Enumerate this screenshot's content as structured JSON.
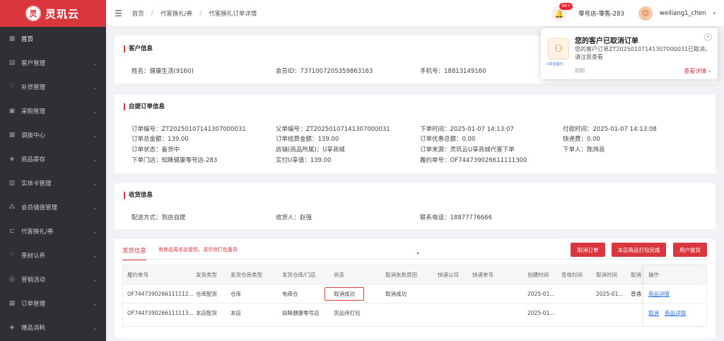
{
  "app": {
    "logo_mark": "灵",
    "logo_text": "灵玑云"
  },
  "sidebar": {
    "items": [
      {
        "label": "首页",
        "icon": "grid-icon",
        "glyph": "▦",
        "arrow": ""
      },
      {
        "label": "客户管理",
        "icon": "customer-icon",
        "glyph": "▤",
        "arrow": "⌄"
      },
      {
        "label": "补货管理",
        "icon": "heart-icon",
        "glyph": "♡",
        "arrow": "⌄"
      },
      {
        "label": "采购管理",
        "icon": "purchase-icon",
        "glyph": "▣",
        "arrow": "⌄"
      },
      {
        "label": "调拨中心",
        "icon": "transfer-icon",
        "glyph": "▦",
        "arrow": "⌄"
      },
      {
        "label": "商品寄存",
        "icon": "box-icon",
        "glyph": "◈",
        "arrow": "⌄"
      },
      {
        "label": "实体卡管理",
        "icon": "card-icon",
        "glyph": "▥",
        "arrow": "⌄"
      },
      {
        "label": "会员储值管理",
        "icon": "member-icon",
        "glyph": "⁂",
        "arrow": "⌄"
      },
      {
        "label": "代客换礼/券",
        "icon": "cart-icon",
        "glyph": "⊏",
        "arrow": "⌄"
      },
      {
        "label": "茶树认养",
        "icon": "tea-icon",
        "glyph": "♡",
        "arrow": "⌄"
      },
      {
        "label": "营销活动",
        "icon": "marketing-icon",
        "glyph": "◎",
        "arrow": "⌄"
      },
      {
        "label": "订单管理",
        "icon": "order-icon",
        "glyph": "▦",
        "arrow": "⌄"
      },
      {
        "label": "赠品消耗",
        "icon": "gift-icon",
        "glyph": "◈",
        "arrow": "⌄"
      }
    ]
  },
  "header": {
    "breadcrumb": [
      "首页",
      "代客换礼/券",
      "代客换礼订单详情"
    ],
    "badge": "99+",
    "store": "零号店-零售-283",
    "username": "weiliang1_chen"
  },
  "toast": {
    "icon_caption": "U享值履约",
    "title": "您的客户已取消订单",
    "body": "您的客户订单ZT20250107141307000031已取消，请注意查看",
    "time": "刚刚",
    "link": "查看详情 ›"
  },
  "customer": {
    "title": "客户信息",
    "name": "姓名：健康生活(9160)",
    "member_id": "会员ID：7371007205359863163",
    "phone": "手机号：18813149160"
  },
  "order": {
    "title": "自提订单信息",
    "fields": [
      "订单编号：ZT20250107141307000031",
      "订单总金额：139.00",
      "订单状态：备货中",
      "下单门店：知睐健康零号店-283",
      "父单编号：ZT20250107141307000031",
      "订单结算金额：139.00",
      "店铺(商品所属)：U享商城",
      "实付U享值：139.00",
      "下单时间：2025-01-07 14:13:07",
      "订单优惠总额：0.00",
      "订单来源：灵玑云U享商城代客下单",
      "履约单号：OF744739026611111300",
      "付款时间：2025-01-07 14:13:08",
      "快递费：0.00",
      "下单人：陈炜良"
    ]
  },
  "receiver": {
    "title": "收货信息",
    "method": "配送方式：到店自提",
    "person": "收货人：赵强",
    "phone": "联系电话：18877776666"
  },
  "shipping": {
    "tab": "发货信息",
    "note": "有商品周本店提供，请尽快打包备货",
    "buttons": [
      "取消订单",
      "本店商品打包完成",
      "用户提货"
    ],
    "columns": [
      "履约单号",
      "发货类型",
      "发货仓库类型",
      "发货仓库/门店",
      "状态",
      "取消失败原因",
      "快递公司",
      "快递单号",
      "创建时间",
      "签收时间",
      "取消时间",
      "取消"
    ],
    "ops_header": "操作",
    "rows": [
      {
        "cells": [
          "OF7447390266111112...",
          "仓库配货",
          "仓库",
          "电商仓",
          "取消成功",
          "取消成功",
          "",
          "",
          "2025-01...",
          "",
          "2025-01...",
          "普通"
        ],
        "ops": [
          "商品详情"
        ]
      },
      {
        "cells": [
          "OF7447390266111113...",
          "本店配货",
          "本店",
          "知睐健康零号店",
          "货品待打包",
          "",
          "",
          "",
          "2025-01...",
          "",
          "",
          ""
        ],
        "ops": [
          "取消",
          "商品详情"
        ]
      }
    ]
  }
}
